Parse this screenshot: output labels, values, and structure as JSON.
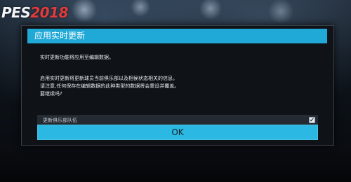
{
  "logo": {
    "prefix": "PES",
    "year": "2018"
  },
  "dialog": {
    "title": "应用实时更新",
    "lines": [
      "实时更新功能将应用至编辑数据。",
      "启用实时更新将更新球员当前俱乐部以及相侯状态相关的信息。",
      "请注意,任何保存在编辑数据的此种类型的数据将会重设并覆盖。",
      "要继续吗?"
    ],
    "option": {
      "label": "更新俱乐部队伍",
      "checked": true,
      "check_glyph": "✔"
    },
    "ok_label": "OK"
  },
  "colors": {
    "accent": "#20a9d6",
    "button": "#2bb8e2",
    "dialog_bg": "#0f1216",
    "logo_year": "#e23b3b"
  }
}
